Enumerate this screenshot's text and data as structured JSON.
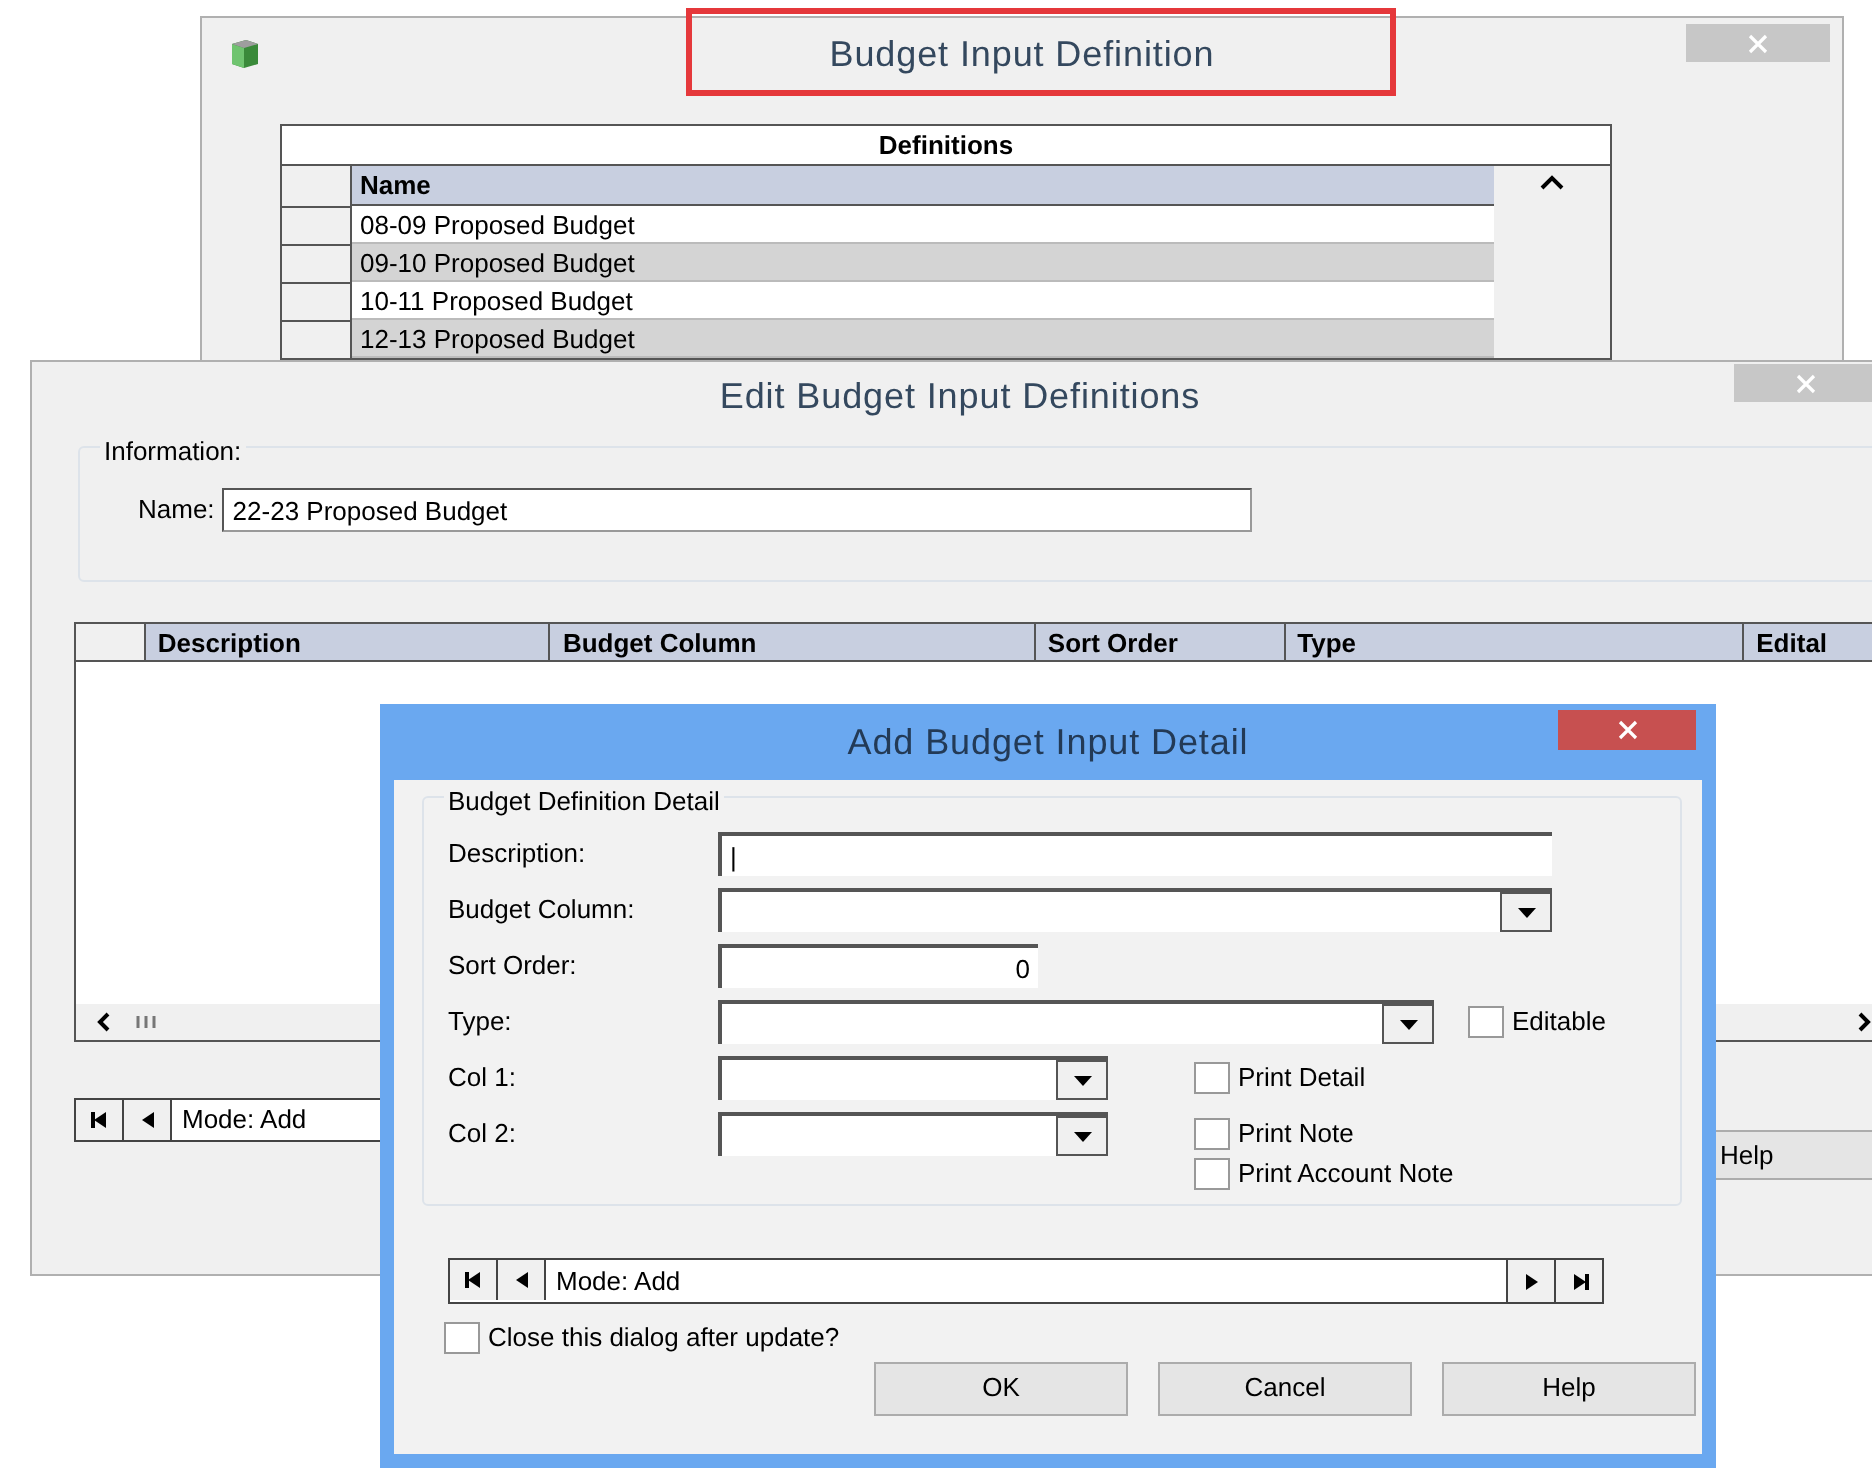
{
  "definition_window": {
    "title": "Budget Input Definition",
    "title_highlighted": true,
    "table": {
      "caption": "Definitions",
      "columns": [
        "Name"
      ],
      "rows": [
        "08-09 Proposed Budget",
        "09-10 Proposed Budget",
        "10-11 Proposed Budget",
        "12-13 Proposed Budget"
      ]
    }
  },
  "edit_window": {
    "title": "Edit Budget Input Definitions",
    "group_label": "Information:",
    "name_label": "Name:",
    "name_value": "22-23 Proposed Budget",
    "grid_columns": [
      "Description",
      "Budget Column",
      "Sort Order",
      "Type",
      "Edital"
    ],
    "mode": "Mode: Add",
    "help_button": "Help"
  },
  "detail_dialog": {
    "title": "Add Budget Input Detail",
    "group_label": "Budget Definition Detail",
    "fields": [
      {
        "label": "Description:",
        "kind": "text",
        "value": "|"
      },
      {
        "label": "Budget Column:",
        "kind": "combo"
      },
      {
        "label": "Sort Order:",
        "kind": "number",
        "value": "0"
      },
      {
        "label": "Type:",
        "kind": "combo",
        "option": {
          "label": "Editable",
          "checked": false
        }
      },
      {
        "label": "Col 1:",
        "kind": "combo",
        "option": {
          "label": "Print Detail",
          "checked": false
        }
      },
      {
        "label": "Col 2:",
        "kind": "combo",
        "option": {
          "label": "Print Note",
          "checked": false
        }
      }
    ],
    "extra_options": [
      {
        "label": "Print Account Note",
        "checked": false
      }
    ],
    "mode": "Mode: Add",
    "close_after_update": {
      "label": "Close this dialog after update?",
      "checked": false
    },
    "buttons": [
      "OK",
      "Cancel",
      "Help"
    ]
  }
}
